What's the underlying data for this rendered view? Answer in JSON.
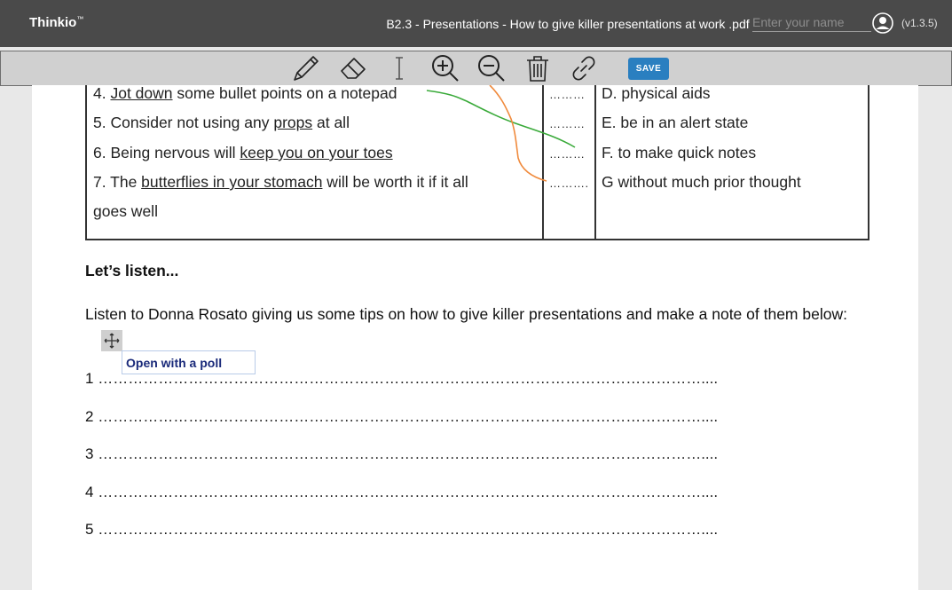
{
  "app": {
    "brand": "Thinkio",
    "trademark": "™",
    "version": "(v1.3.5)"
  },
  "document_title": "B2.3 - Presentations - How to give killer presentations at work .pdf",
  "name_input": {
    "placeholder": "Enter your name",
    "value": ""
  },
  "toolbar": {
    "tools": [
      "pencil-icon",
      "eraser-icon",
      "text-cursor-icon",
      "zoom-in-icon",
      "zoom-out-icon",
      "trash-icon",
      "link-icon"
    ],
    "save_label": "SAVE"
  },
  "colors": {
    "topbar": "#4a4a4a",
    "toolbar": "#d0d0d0",
    "save": "#2a7fc0",
    "green_line": "#3aaa3a",
    "orange_line": "#f08a3c",
    "note_text": "#1a2a7a"
  },
  "table": {
    "rows": [
      {
        "num": "4. ",
        "pre": "",
        "phrase": "Jot down",
        "post": " some bullet points on a notepad",
        "dots": "………",
        "answer": "D. physical aids"
      },
      {
        "num": "5. ",
        "pre": "Consider not using any ",
        "phrase": "props",
        "post": " at all",
        "dots": "………",
        "answer": "E. be in an alert state"
      },
      {
        "num": "6. ",
        "pre": "Being nervous will ",
        "phrase": "keep you on your toes",
        "post": "",
        "dots": "………",
        "answer": "F. to make quick notes"
      },
      {
        "num": "7. ",
        "pre": "The ",
        "phrase": "butterflies in your stomach",
        "post": " will be worth it if it all",
        "dots": "……….",
        "answer": "G without much prior thought"
      }
    ],
    "continuation": "goes well"
  },
  "section": {
    "heading": "Let’s listen...",
    "paragraph": "Listen to Donna Rosato giving us some tips on how to give killer presentations and make a note of them below:"
  },
  "answer_lines": [
    {
      "num": "1",
      "dots": "…………………………………………………………………………………………………………...."
    },
    {
      "num": "2",
      "dots": "…………………………………………………………………………………………………………...."
    },
    {
      "num": "3",
      "dots": "…………………………………………………………………………………………………………...."
    },
    {
      "num": "4",
      "dots": "…………………………………………………………………………………………………………...."
    },
    {
      "num": "5",
      "dots": "…………………………………………………………………………………………………………...."
    }
  ],
  "note": {
    "text": "Open with a poll"
  }
}
